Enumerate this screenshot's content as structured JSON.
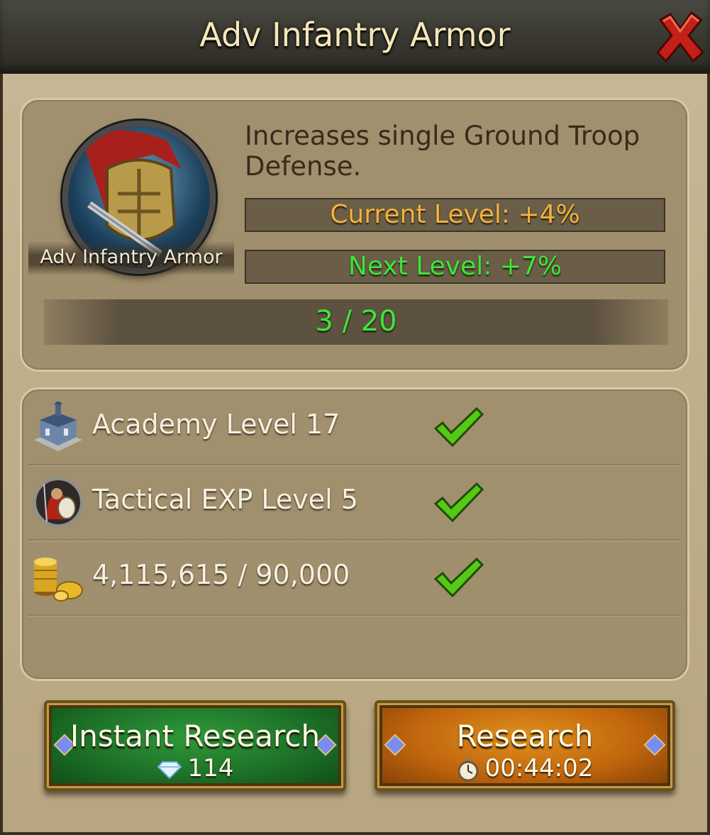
{
  "title": "Adv Infantry Armor",
  "icons": {
    "close": "close-x-icon",
    "research_item": "infantry-armor-icon",
    "academy": "academy-building-icon",
    "tactical": "spartan-warrior-icon",
    "gold": "gold-coins-icon",
    "check": "checkmark-icon",
    "diamond": "diamond-icon",
    "timer": "stopwatch-icon"
  },
  "research": {
    "name": "Adv Infantry Armor",
    "description": "Increases single Ground Troop Defense.",
    "current_level": "Current Level: +4%",
    "next_level": "Next Level: +7%",
    "progress_text": "3 / 20",
    "progress_fraction": 0.15
  },
  "requirements": [
    {
      "label": "Academy Level 17",
      "met": true
    },
    {
      "label": "Tactical EXP Level 5",
      "met": true
    },
    {
      "label": "4,115,615 / 90,000",
      "met": true
    }
  ],
  "buttons": {
    "instant_label": "Instant Research",
    "instant_cost": "114",
    "research_label": "Research",
    "research_time": "00:44:02"
  },
  "colors": {
    "current_level": "#f3b23c",
    "next_level": "#3ee638",
    "instant_button": "#1d7027",
    "research_button": "#c0650d"
  }
}
